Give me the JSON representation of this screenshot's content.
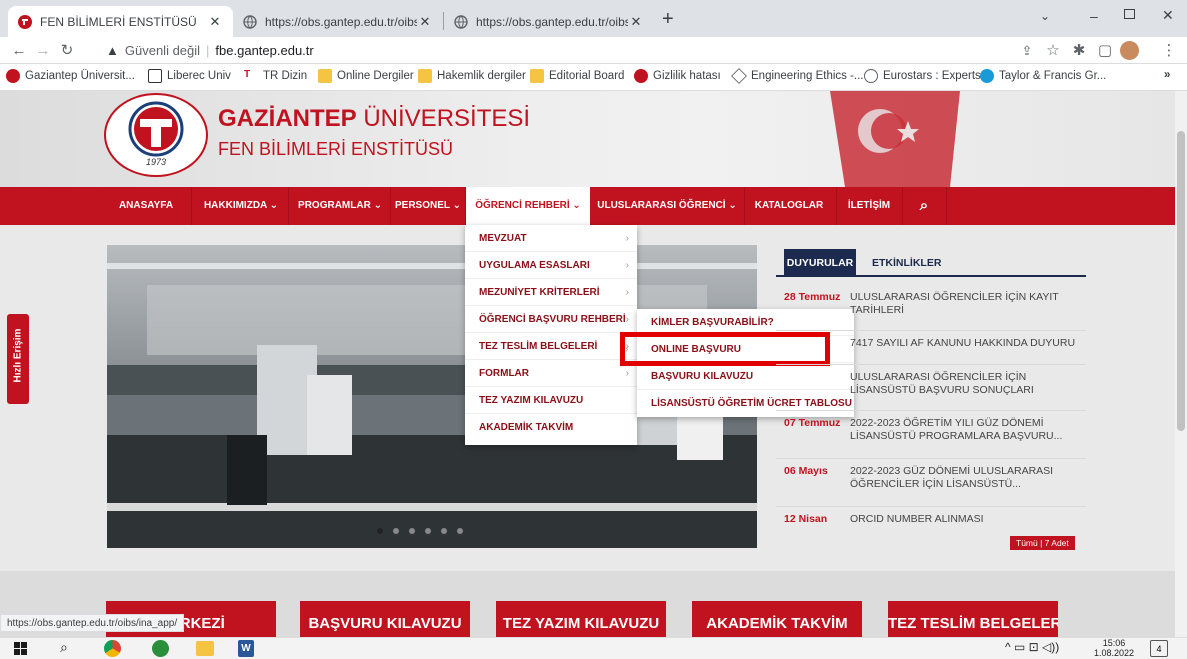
{
  "browser": {
    "tabs": [
      {
        "title": "FEN BİLİMLERİ ENSTİTÜSÜ",
        "active": true
      },
      {
        "title": "https://obs.gantep.edu.tr/oibs/ina",
        "active": false
      },
      {
        "title": "https://obs.gantep.edu.tr/oibs/ina",
        "active": false
      }
    ],
    "new_tab": "+",
    "security": "Güvenli değil",
    "url": "fbe.gantep.edu.tr",
    "bookmarks": [
      "Gaziantep Üniversit...",
      "Liberec Univ",
      "TR Dizin",
      "Online Dergiler",
      "Hakemlik dergiler",
      "Editorial Board",
      "Gizlilik hatası",
      "Engineering Ethics -...",
      "Eurostars : Experts",
      "Taylor & Francis Gr..."
    ],
    "bookmarks_more": "»",
    "status_url": "https://obs.gantep.edu.tr/oibs/ina_app/"
  },
  "site": {
    "brand_bold": "GAZİANTEP",
    "brand_rest": " ÜNİVERSİTESİ",
    "subtitle": "FEN BİLİMLERİ ENSTİTÜSÜ",
    "seal_year": "1973",
    "menu": [
      "ANASAYFA",
      "HAKKIMIZDA ⌄",
      "PROGRAMLAR ⌄",
      "PERSONEL ⌄",
      "ÖĞRENCİ REHBERİ ⌄",
      "ULUSLARARASI ÖĞRENCİ ⌄",
      "KATALOGLAR",
      "İLETİŞİM"
    ],
    "dropdown": [
      "MEVZUAT",
      "UYGULAMA ESASLARI",
      "MEZUNİYET KRİTERLERİ",
      "ÖĞRENCİ BAŞVURU REHBERİ",
      "TEZ TESLİM BELGELERİ",
      "FORMLAR",
      "TEZ YAZIM KILAVUZU",
      "AKADEMİK TAKVİM"
    ],
    "submenu": [
      "KİMLER BAŞVURABİLİR?",
      "ONLINE BAŞVURU",
      "BAŞVURU KILAVUZU",
      "LİSANSÜSTÜ ÖĞRETİM ÜCRET TABLOSU"
    ],
    "hizli": "Hızlı Erişim",
    "news_tabs": [
      "DUYURULAR",
      "ETKİNLİKLER"
    ],
    "news": [
      {
        "date": "28 Temmuz",
        "text": "ULUSLARARASI ÖĞRENCİLER İÇİN KAYIT TARİHLERİ"
      },
      {
        "date": "",
        "text": "7417 SAYILI AF KANUNU HAKKINDA DUYURU"
      },
      {
        "date": "",
        "text": "ULUSLARARASI ÖĞRENCİLER İÇİN LİSANSÜSTÜ BAŞVURU SONUÇLARI"
      },
      {
        "date": "07 Temmuz",
        "text": "2022-2023 ÖĞRETİM YILI GÜZ DÖNEMİ LİSANSÜSTÜ PROGRAMLARA BAŞVURU..."
      },
      {
        "date": "06 Mayıs",
        "text": "2022-2023 GÜZ DÖNEMİ ULUSLARARASI ÖĞRENCİLER İÇİN LİSANSÜSTÜ..."
      },
      {
        "date": "12 Nisan",
        "text": "ORCID NUMBER ALINMASI"
      }
    ],
    "news_all": "Tümü | 7 Adet",
    "cards": [
      "MERKEZİ",
      "BAŞVURU KILAVUZU",
      "TEZ YAZIM KILAVUZU",
      "AKADEMİK TAKVİM",
      "TEZ TESLİM BELGELERİ"
    ],
    "accent": "#c1121f"
  },
  "taskbar": {
    "time": "15:06",
    "date": "1.08.2022",
    "notifications": "4"
  }
}
